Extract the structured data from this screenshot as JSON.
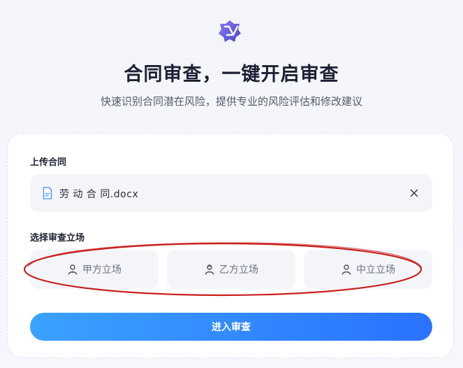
{
  "header": {
    "logo_icon": "app-logo-icon",
    "title": "合同审查，一键开启审查",
    "subtitle": "快速识别合同潜在风险，提供专业的风险评估和修改建议"
  },
  "upload": {
    "label": "上传合同",
    "file_name": "劳 动 合 同.docx",
    "file_icon": "document-icon",
    "remove_icon": "close-icon"
  },
  "stance": {
    "label": "选择审查立场",
    "options": [
      {
        "label": "甲方立场",
        "icon": "person-icon"
      },
      {
        "label": "乙方立场",
        "icon": "person-icon"
      },
      {
        "label": "中立立场",
        "icon": "person-icon"
      }
    ]
  },
  "submit": {
    "label": "进入审查"
  },
  "colors": {
    "primary_gradient_start": "#3aa2ff",
    "primary_gradient_end": "#2a72ff",
    "annotation_red": "#c8201e"
  }
}
